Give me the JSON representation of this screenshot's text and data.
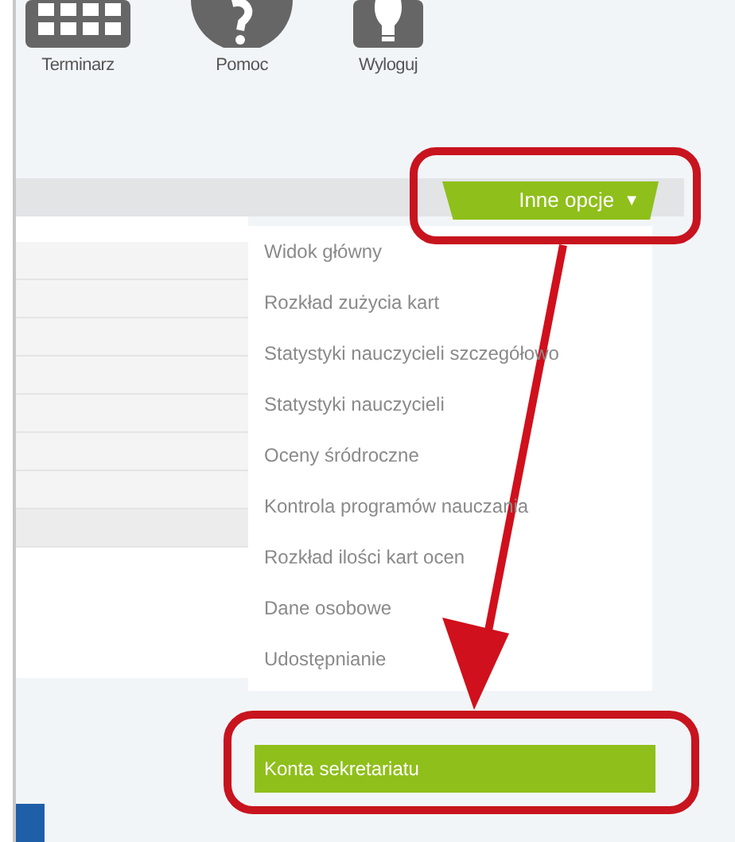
{
  "toolbar": [
    {
      "label": "Terminarz",
      "kind": "calendar"
    },
    {
      "label": "Pomoc",
      "kind": "help"
    },
    {
      "label": "Wyloguj",
      "kind": "logout"
    }
  ],
  "options_button": {
    "label": "Inne opcje",
    "caret": "▼"
  },
  "menu": [
    {
      "label": "Widok główny",
      "selected": false
    },
    {
      "label": "Rozkład zużycia kart",
      "selected": false
    },
    {
      "label": "Statystyki nauczycieli szczegółowo",
      "selected": false
    },
    {
      "label": "Statystyki nauczycieli",
      "selected": false
    },
    {
      "label": "Oceny śródroczne",
      "selected": false
    },
    {
      "label": "Kontrola programów nauczania",
      "selected": false
    },
    {
      "label": "Rozkład ilości kart ocen",
      "selected": false
    },
    {
      "label": "Dane osobowe",
      "selected": false
    },
    {
      "label": "Udostępnianie",
      "selected": false
    },
    {
      "label": "Konta sekretariatu",
      "selected": true
    }
  ]
}
